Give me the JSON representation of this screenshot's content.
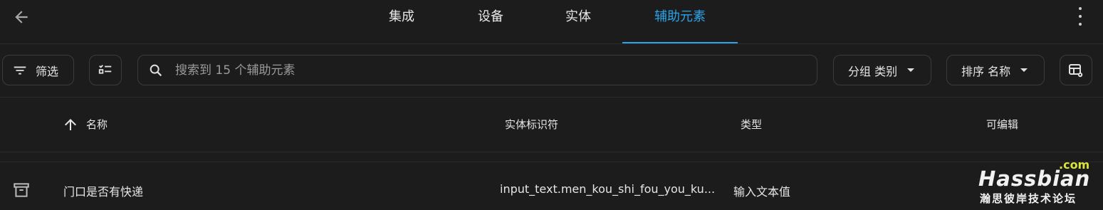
{
  "nav": {
    "back_icon": "arrow-left-icon",
    "tabs": [
      {
        "label": "集成",
        "active": false
      },
      {
        "label": "设备",
        "active": false
      },
      {
        "label": "实体",
        "active": false
      },
      {
        "label": "辅助元素",
        "active": true
      }
    ],
    "menu_icon": "dots-vertical-icon",
    "accent_color": "#2aa3e8"
  },
  "toolbar": {
    "filter_label": "筛选",
    "filter_icon": "filter-lines-icon",
    "select_icon": "checklist-icon",
    "search_placeholder": "搜索到 15 个辅助元素",
    "search_value": "",
    "group_label": "分组 类别",
    "sort_label": "排序 名称",
    "columns_icon": "table-settings-icon"
  },
  "table": {
    "sort_icon": "arrow-up-icon",
    "columns": [
      "名称",
      "实体标识符",
      "类型",
      "可编辑"
    ],
    "rows": [
      {
        "icon": "archive-icon",
        "name": "门口是否有快递",
        "entity_id": "input_text.men_kou_shi_fou_you_ku...",
        "type": "输入文本值",
        "editable": ""
      }
    ]
  },
  "watermark": {
    "top": ".com",
    "main": "Hassbian",
    "sub": "瀚思彼岸技术论坛"
  }
}
